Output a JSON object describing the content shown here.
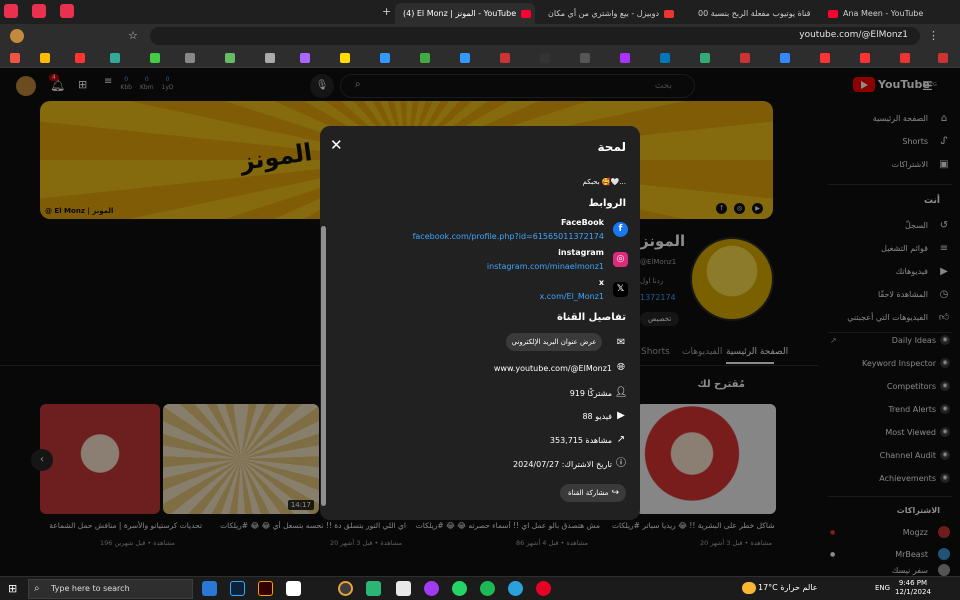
{
  "browser": {
    "tabs": [
      {
        "label": "قناة يوتيوب مفعلة الربح بنسبة 00"
      },
      {
        "label": "دوبيزل - بيع واشتري من أي مكان"
      },
      {
        "label": "(4) El Monz | المونز - YouTube"
      },
      {
        "label": "Ana Meen - YouTube"
      }
    ],
    "new_tab": "+",
    "url": "youtube.com/@ElMonz1"
  },
  "yt": {
    "logo_text": "YouTube",
    "logo_country": "EG",
    "search_placeholder": "بحث",
    "notif_count": "4",
    "stats": [
      {
        "value": "0",
        "label": "Kbb"
      },
      {
        "value": "0",
        "label": "Kbm"
      },
      {
        "value": "0",
        "label": "1yD"
      }
    ]
  },
  "channel": {
    "banner_title": "المونز",
    "banner_handle": "@ El Monz | المونز",
    "name": "المونز",
    "handle_partial": "@ElMonz1",
    "desc_partial": "ردنا اول",
    "number_partial": "1372174",
    "customize": "تخصيص",
    "tabs": [
      "الصفحة الرئيسية",
      "الفيديوهات",
      "Shorts"
    ],
    "section_title": "مُقترح لك"
  },
  "videos": [
    {
      "title": "كروبان مشاكل خطر على البشرية !! 😂 ريديا سباتر #ريلكات",
      "meta": "20 مشاهدة • قبل 3 أشهر"
    },
    {
      "title": "مش هتصدق بالو عمل اي !! أسماء حصرته 😂 😂 #ريلكات",
      "meta": "86 مشاهدة • قبل 4 أشهر"
    },
    {
      "title": "اي اللي التور بتسلق دة !! نحسه بتسعل أي 😂 😂 #ريلكات",
      "meta": "20 مشاهدة • قبل 3 أشهر"
    },
    {
      "title": "تحديات كرستيانو والأسرة | منافش حمل الشماعة",
      "meta": "196 مشاهدة • قبل شهرين"
    }
  ],
  "video_duration": "14:17",
  "sidebar": {
    "main": [
      "الصفحة الرئيسية",
      "Shorts",
      "الاشتراكات"
    ],
    "you_label": "أنت",
    "you": [
      "السجلّ",
      "قوائم التشغيل",
      "فيديوهاتك",
      "المشاهدة لاحقًا",
      "الفيديوهات التي أعجبتني"
    ],
    "ext": [
      "Daily Ideas",
      "Keyword Inspector",
      "Competitors",
      "Trend Alerts",
      "Most Viewed",
      "Channel Audit",
      "Achievements"
    ],
    "subs_label": "الاشتراكات",
    "subs": [
      "Mogzz",
      "MrBeast",
      "سفر نيسك"
    ]
  },
  "modal": {
    "title": "لمحة",
    "desc": "بحبكم 🥰🤍...",
    "links_heading": "الروابط",
    "links": [
      {
        "name": "FaceBook",
        "url": "facebook.com/profile.php?id=61565011372174",
        "icon": "facebook-icon",
        "color": "#1877f2"
      },
      {
        "name": "instagram",
        "url": "instagram.com/minaelmonz1",
        "icon": "instagram-icon",
        "color": "#dd2a7b"
      },
      {
        "name": "x",
        "url": "x.com/El_Monz1",
        "icon": "x-icon",
        "color": "#000000"
      }
    ],
    "details_heading": "تفاصيل القناة",
    "email_button": "عرض عنوان البريد الإلكتروني",
    "channel_url": "www.youtube.com/@ElMonz1",
    "subscribers": "919 مشتركًا",
    "videos": "88 فيديو",
    "views": "353,715 مشاهدة",
    "joined": "تاريخ الاشتراك: 2024/07/27",
    "share_button": "مشاركة القناة"
  },
  "taskbar": {
    "search": "Type here to search",
    "weather": "17°C عالم حرارة",
    "lang": "ENG",
    "time": "9:46 PM",
    "date": "12/1/2024"
  },
  "colors": {
    "accent_red": "#ff0000",
    "link_blue": "#3ea6ff",
    "modal_bg": "#212121",
    "page_bg": "#0f0f0f"
  }
}
